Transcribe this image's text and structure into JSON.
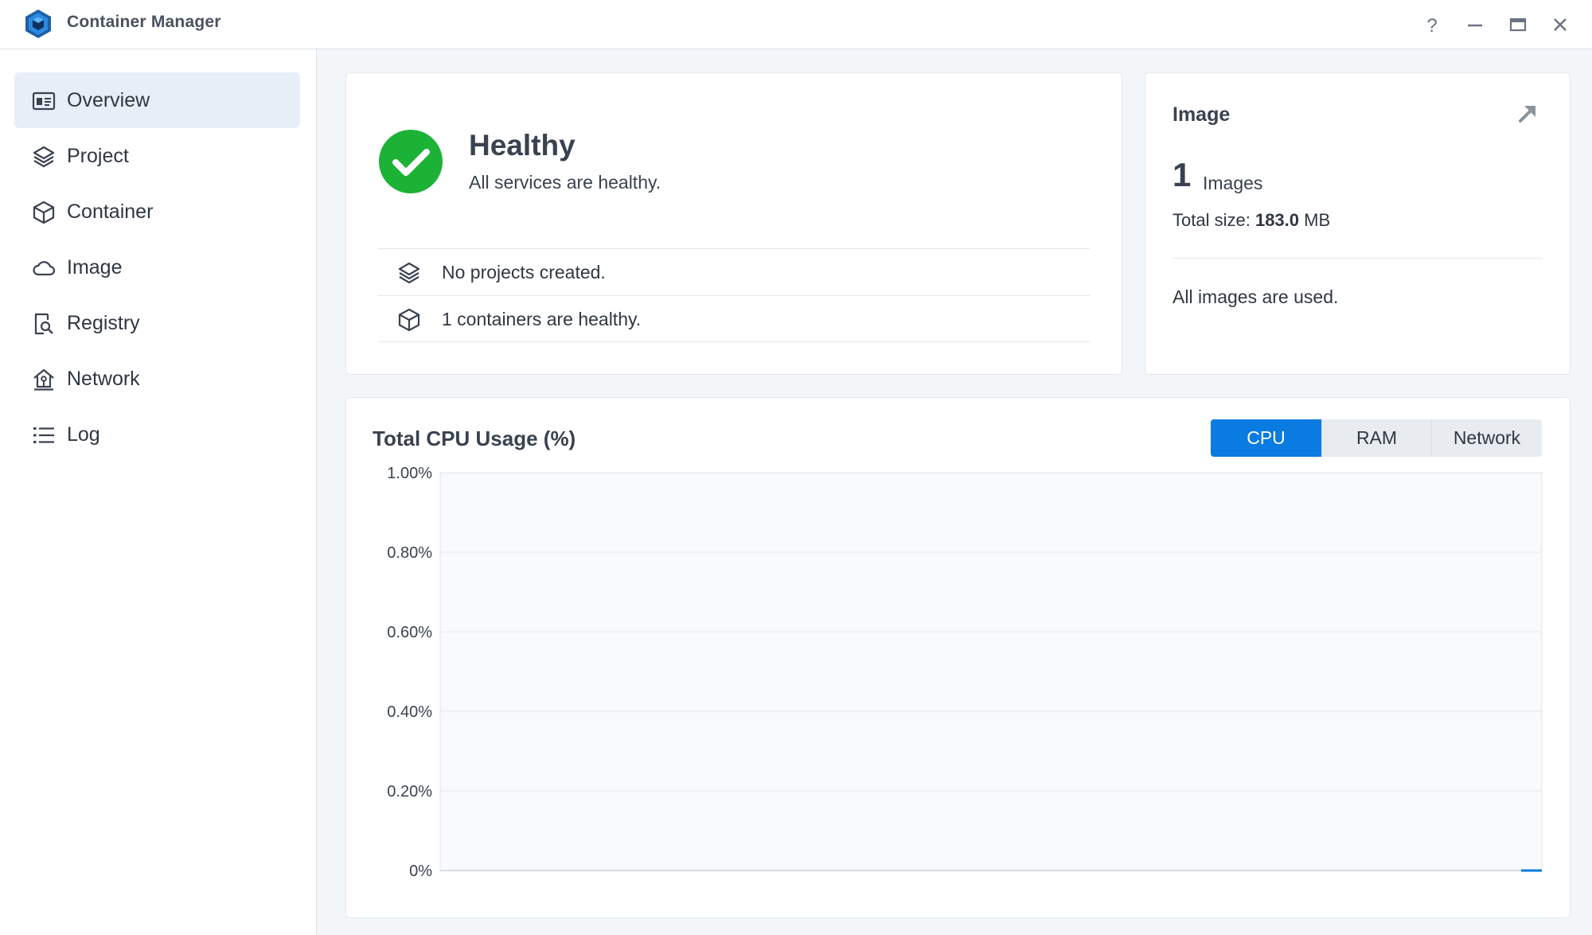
{
  "app": {
    "title": "Container Manager",
    "accent": "#0a7be0",
    "success": "#1cb236"
  },
  "window_controls": [
    {
      "name": "help-button",
      "icon": "question-icon"
    },
    {
      "name": "minimize-button",
      "icon": "minimize-icon"
    },
    {
      "name": "maximize-button",
      "icon": "maximize-icon"
    },
    {
      "name": "close-button",
      "icon": "close-icon"
    }
  ],
  "sidebar": {
    "items": [
      {
        "label": "Overview",
        "icon": "overview-icon",
        "active": true
      },
      {
        "label": "Project",
        "icon": "layers-icon"
      },
      {
        "label": "Container",
        "icon": "cube-icon"
      },
      {
        "label": "Image",
        "icon": "cloud-icon"
      },
      {
        "label": "Registry",
        "icon": "registry-search-icon"
      },
      {
        "label": "Network",
        "icon": "network-house-icon"
      },
      {
        "label": "Log",
        "icon": "list-icon"
      }
    ]
  },
  "health": {
    "status": "Healthy",
    "subtitle": "All services are healthy.",
    "rows": [
      {
        "text": "No projects created.",
        "icon": "layers-icon"
      },
      {
        "text": "1 containers are healthy.",
        "icon": "cube-icon"
      }
    ]
  },
  "image_summary": {
    "title": "Image",
    "count": "1",
    "count_label": "Images",
    "size_label": "Total size:",
    "size_value": "183.0",
    "size_unit": "MB",
    "status": "All images are used."
  },
  "usage": {
    "title": "Total CPU Usage (%)",
    "tabs": [
      "CPU",
      "RAM",
      "Network"
    ],
    "active_tab": "CPU"
  },
  "chart_data": {
    "type": "line",
    "title": "Total CPU Usage (%)",
    "xlabel": "",
    "ylabel": "",
    "ylim": [
      0,
      1
    ],
    "y_ticks": [
      0,
      0.2,
      0.4,
      0.6,
      0.8,
      1.0
    ],
    "y_tick_labels": [
      "0%",
      "0.20%",
      "0.40%",
      "0.60%",
      "0.80%",
      "1.00%"
    ],
    "grid": true,
    "series": [
      {
        "color": "#0a7be0",
        "values": [
          0,
          0
        ]
      }
    ]
  }
}
